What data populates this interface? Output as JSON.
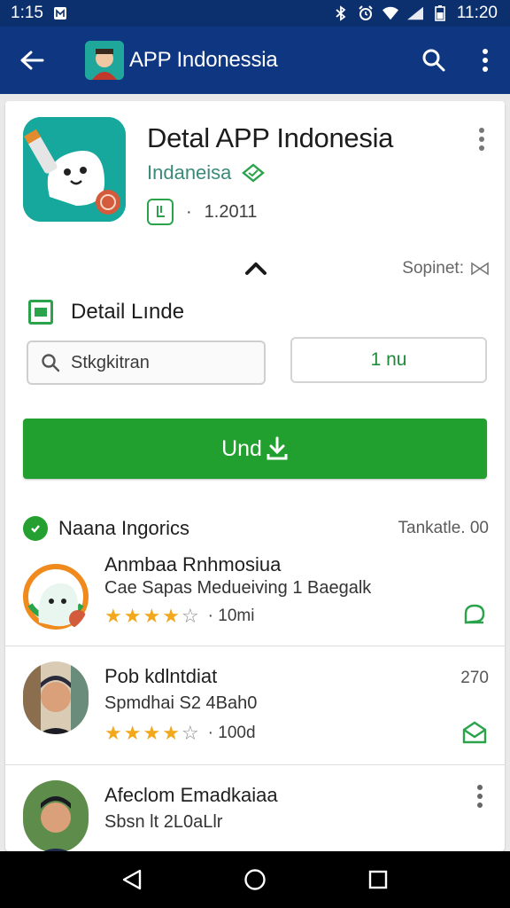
{
  "status_bar": {
    "time_left": "1:15",
    "time_right": "11:20"
  },
  "toolbar": {
    "title": "APP Indonessia"
  },
  "app": {
    "name": "Detal APP Indonesia",
    "developer": "Indaneisa",
    "version": "1.2011"
  },
  "collapse": {
    "label": "Sopinet:"
  },
  "detail_section": {
    "title": "Detail Lınde",
    "search_value": "Stkgkitran",
    "secondary_button": "1 nu",
    "primary_button": "Und"
  },
  "list": {
    "header": "Naana Ingorics",
    "header_right": "Tankatle. 00",
    "items": [
      {
        "title": "Anmbaa Rnhmosiua",
        "subtitle": "Cae Sapas Medueiving 1 Baegalk",
        "stars": 4,
        "count": "· 10mi"
      },
      {
        "title": "Pob kdlntdiat",
        "subtitle": "Spmdhai S2 4Bah0",
        "stars": 4,
        "count": "· 100d",
        "right_text": "270"
      },
      {
        "title": "Afeclom Emadkaiaa",
        "subtitle": "Sbsn lt 2L0aLlr"
      }
    ]
  },
  "colors": {
    "toolbar": "#0f3680",
    "status": "#0c2f6e",
    "accent_green": "#22a02f",
    "star": "#f2a81d"
  }
}
